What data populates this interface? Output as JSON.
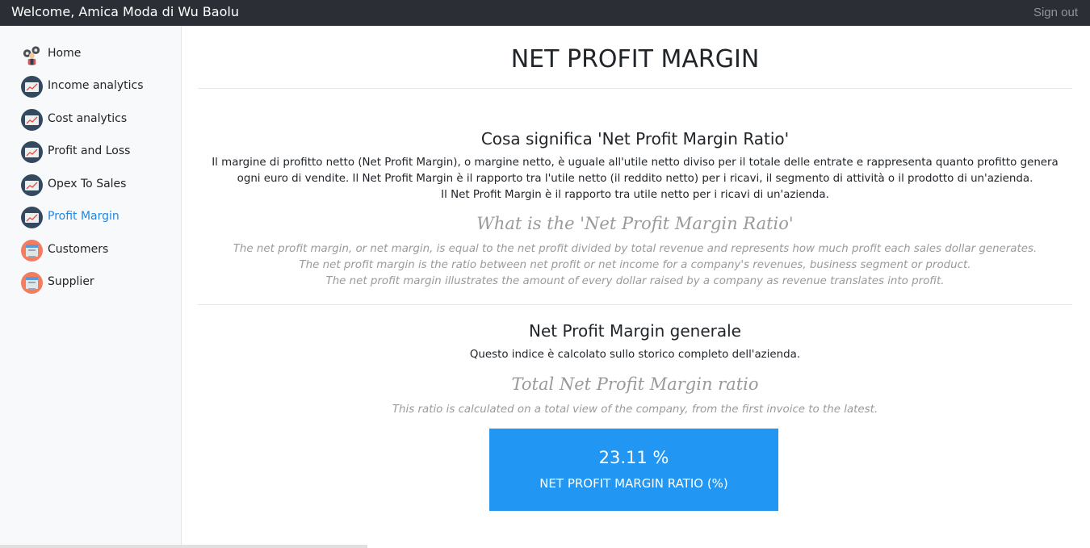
{
  "topbar": {
    "welcome": "Welcome, Amica Moda di Wu Baolu",
    "signout": "Sign out"
  },
  "sidebar": {
    "items": [
      {
        "label": "Home",
        "icon": "home-icon",
        "active": false
      },
      {
        "label": "Income analytics",
        "icon": "chart-icon",
        "active": false
      },
      {
        "label": "Cost analytics",
        "icon": "chart-icon",
        "active": false
      },
      {
        "label": "Profit and Loss",
        "icon": "chart-icon",
        "active": false
      },
      {
        "label": "Opex To Sales",
        "icon": "chart-icon",
        "active": false
      },
      {
        "label": "Profit Margin",
        "icon": "chart-icon",
        "active": true
      },
      {
        "label": "Customers",
        "icon": "people-icon",
        "active": false
      },
      {
        "label": "Supplier",
        "icon": "people-icon",
        "active": false
      }
    ]
  },
  "main": {
    "title": "NET PROFIT MARGIN",
    "definition": {
      "heading_it": "Cosa significa 'Net Profit Margin Ratio'",
      "lines_it": [
        "Il margine di profitto netto (Net Profit Margin), o margine netto, è uguale all'utile netto diviso per il totale delle entrate e rappresenta quanto profitto genera",
        "ogni euro di vendite. Il Net Profit Margin è il rapporto tra l'utile netto (il reddito netto) per i ricavi, il segmento di attività o il prodotto di un'azienda.",
        "Il Net Profit Margin è il rapporto tra utile netto per i ricavi di un'azienda."
      ],
      "heading_en": "What is the 'Net Profit Margin Ratio'",
      "lines_en": [
        "The net profit margin, or net margin, is equal to the net profit divided by total revenue and represents how much profit each sales dollar generates.",
        "The net profit margin is the ratio between net profit or net income for a company's revenues, business segment or product.",
        "The net profit margin illustrates the amount of every dollar raised by a company as revenue translates into profit."
      ]
    },
    "general": {
      "heading_it": "Net Profit Margin generale",
      "text_it": "Questo indice è calcolato sullo storico completo dell'azienda.",
      "heading_en": "Total Net Profit Margin ratio",
      "text_en": "This ratio is calculated on a total view of the company, from the first invoice to the latest."
    },
    "kpi": {
      "value": "23.11 %",
      "label": "NET PROFIT MARGIN RATIO (%)",
      "color": "#2196f3"
    }
  },
  "colors": {
    "topbar": "#2b2f35",
    "active_link": "#1e88e5",
    "muted_text": "#9a9a9a"
  }
}
